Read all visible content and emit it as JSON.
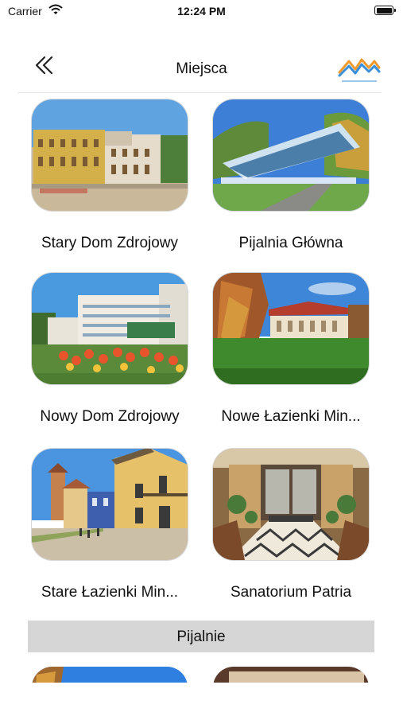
{
  "status_bar": {
    "carrier": "Carrier",
    "time": "12:24 PM"
  },
  "nav": {
    "title": "Miejsca",
    "back_icon": "double-chevron-left-icon",
    "logo_name": "mountains-logo"
  },
  "places": [
    {
      "label": "Stary Dom Zdrojowy"
    },
    {
      "label": "Pijalnia Główna"
    },
    {
      "label": "Nowy Dom Zdrojowy"
    },
    {
      "label": "Nowe Łazienki Min..."
    },
    {
      "label": "Stare Łazienki Min..."
    },
    {
      "label": "Sanatorium Patria"
    }
  ],
  "section": {
    "title": "Pijalnie"
  },
  "colors": {
    "accent_blue": "#3a8fd9",
    "accent_orange": "#f29a2e",
    "section_bg": "#d6d6d6"
  }
}
